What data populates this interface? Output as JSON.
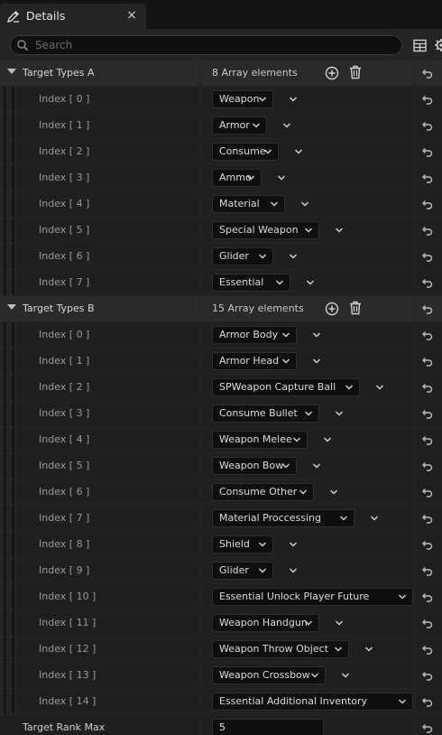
{
  "tab": {
    "title": "Details",
    "close": "×"
  },
  "search": {
    "placeholder": "Search",
    "value": ""
  },
  "groupA": {
    "label": "Target Types A",
    "count": "8 Array elements",
    "items": [
      {
        "index": "Index [ 0 ]",
        "value": "Weapon"
      },
      {
        "index": "Index [ 1 ]",
        "value": "Armor"
      },
      {
        "index": "Index [ 2 ]",
        "value": "Consume"
      },
      {
        "index": "Index [ 3 ]",
        "value": "Ammo"
      },
      {
        "index": "Index [ 4 ]",
        "value": "Material"
      },
      {
        "index": "Index [ 5 ]",
        "value": "Special Weapon"
      },
      {
        "index": "Index [ 6 ]",
        "value": "Glider"
      },
      {
        "index": "Index [ 7 ]",
        "value": "Essential"
      }
    ]
  },
  "groupB": {
    "label": "Target Types B",
    "count": "15 Array elements",
    "items": [
      {
        "index": "Index [ 0 ]",
        "value": "Armor Body"
      },
      {
        "index": "Index [ 1 ]",
        "value": "Armor Head"
      },
      {
        "index": "Index [ 2 ]",
        "value": "SPWeapon Capture Ball"
      },
      {
        "index": "Index [ 3 ]",
        "value": "Consume Bullet"
      },
      {
        "index": "Index [ 4 ]",
        "value": "Weapon Melee"
      },
      {
        "index": "Index [ 5 ]",
        "value": "Weapon Bow"
      },
      {
        "index": "Index [ 6 ]",
        "value": "Consume Other"
      },
      {
        "index": "Index [ 7 ]",
        "value": "Material Proccessing"
      },
      {
        "index": "Index [ 8 ]",
        "value": "Shield"
      },
      {
        "index": "Index [ 9 ]",
        "value": "Glider"
      },
      {
        "index": "Index [ 10 ]",
        "value": "Essential Unlock Player Future"
      },
      {
        "index": "Index [ 11 ]",
        "value": "Weapon Handgun"
      },
      {
        "index": "Index [ 12 ]",
        "value": "Weapon Throw Object"
      },
      {
        "index": "Index [ 13 ]",
        "value": "Weapon Crossbow"
      },
      {
        "index": "Index [ 14 ]",
        "value": "Essential Additional Inventory"
      }
    ]
  },
  "rankMax": {
    "label": "Target Rank Max",
    "value": "5"
  },
  "icons": {
    "tab": "pencil-icon",
    "search": "search-icon",
    "table": "table-icon",
    "settings": "gear-icon",
    "add": "plus-circle-icon",
    "remove": "trash-icon",
    "reset": "reset-arrow-icon",
    "combo": "chevron-down-icon"
  },
  "colors": {
    "panel": "#242424",
    "row": "#1f1f1f",
    "field": "#0f0f0f",
    "text": "#c0c0c0"
  }
}
